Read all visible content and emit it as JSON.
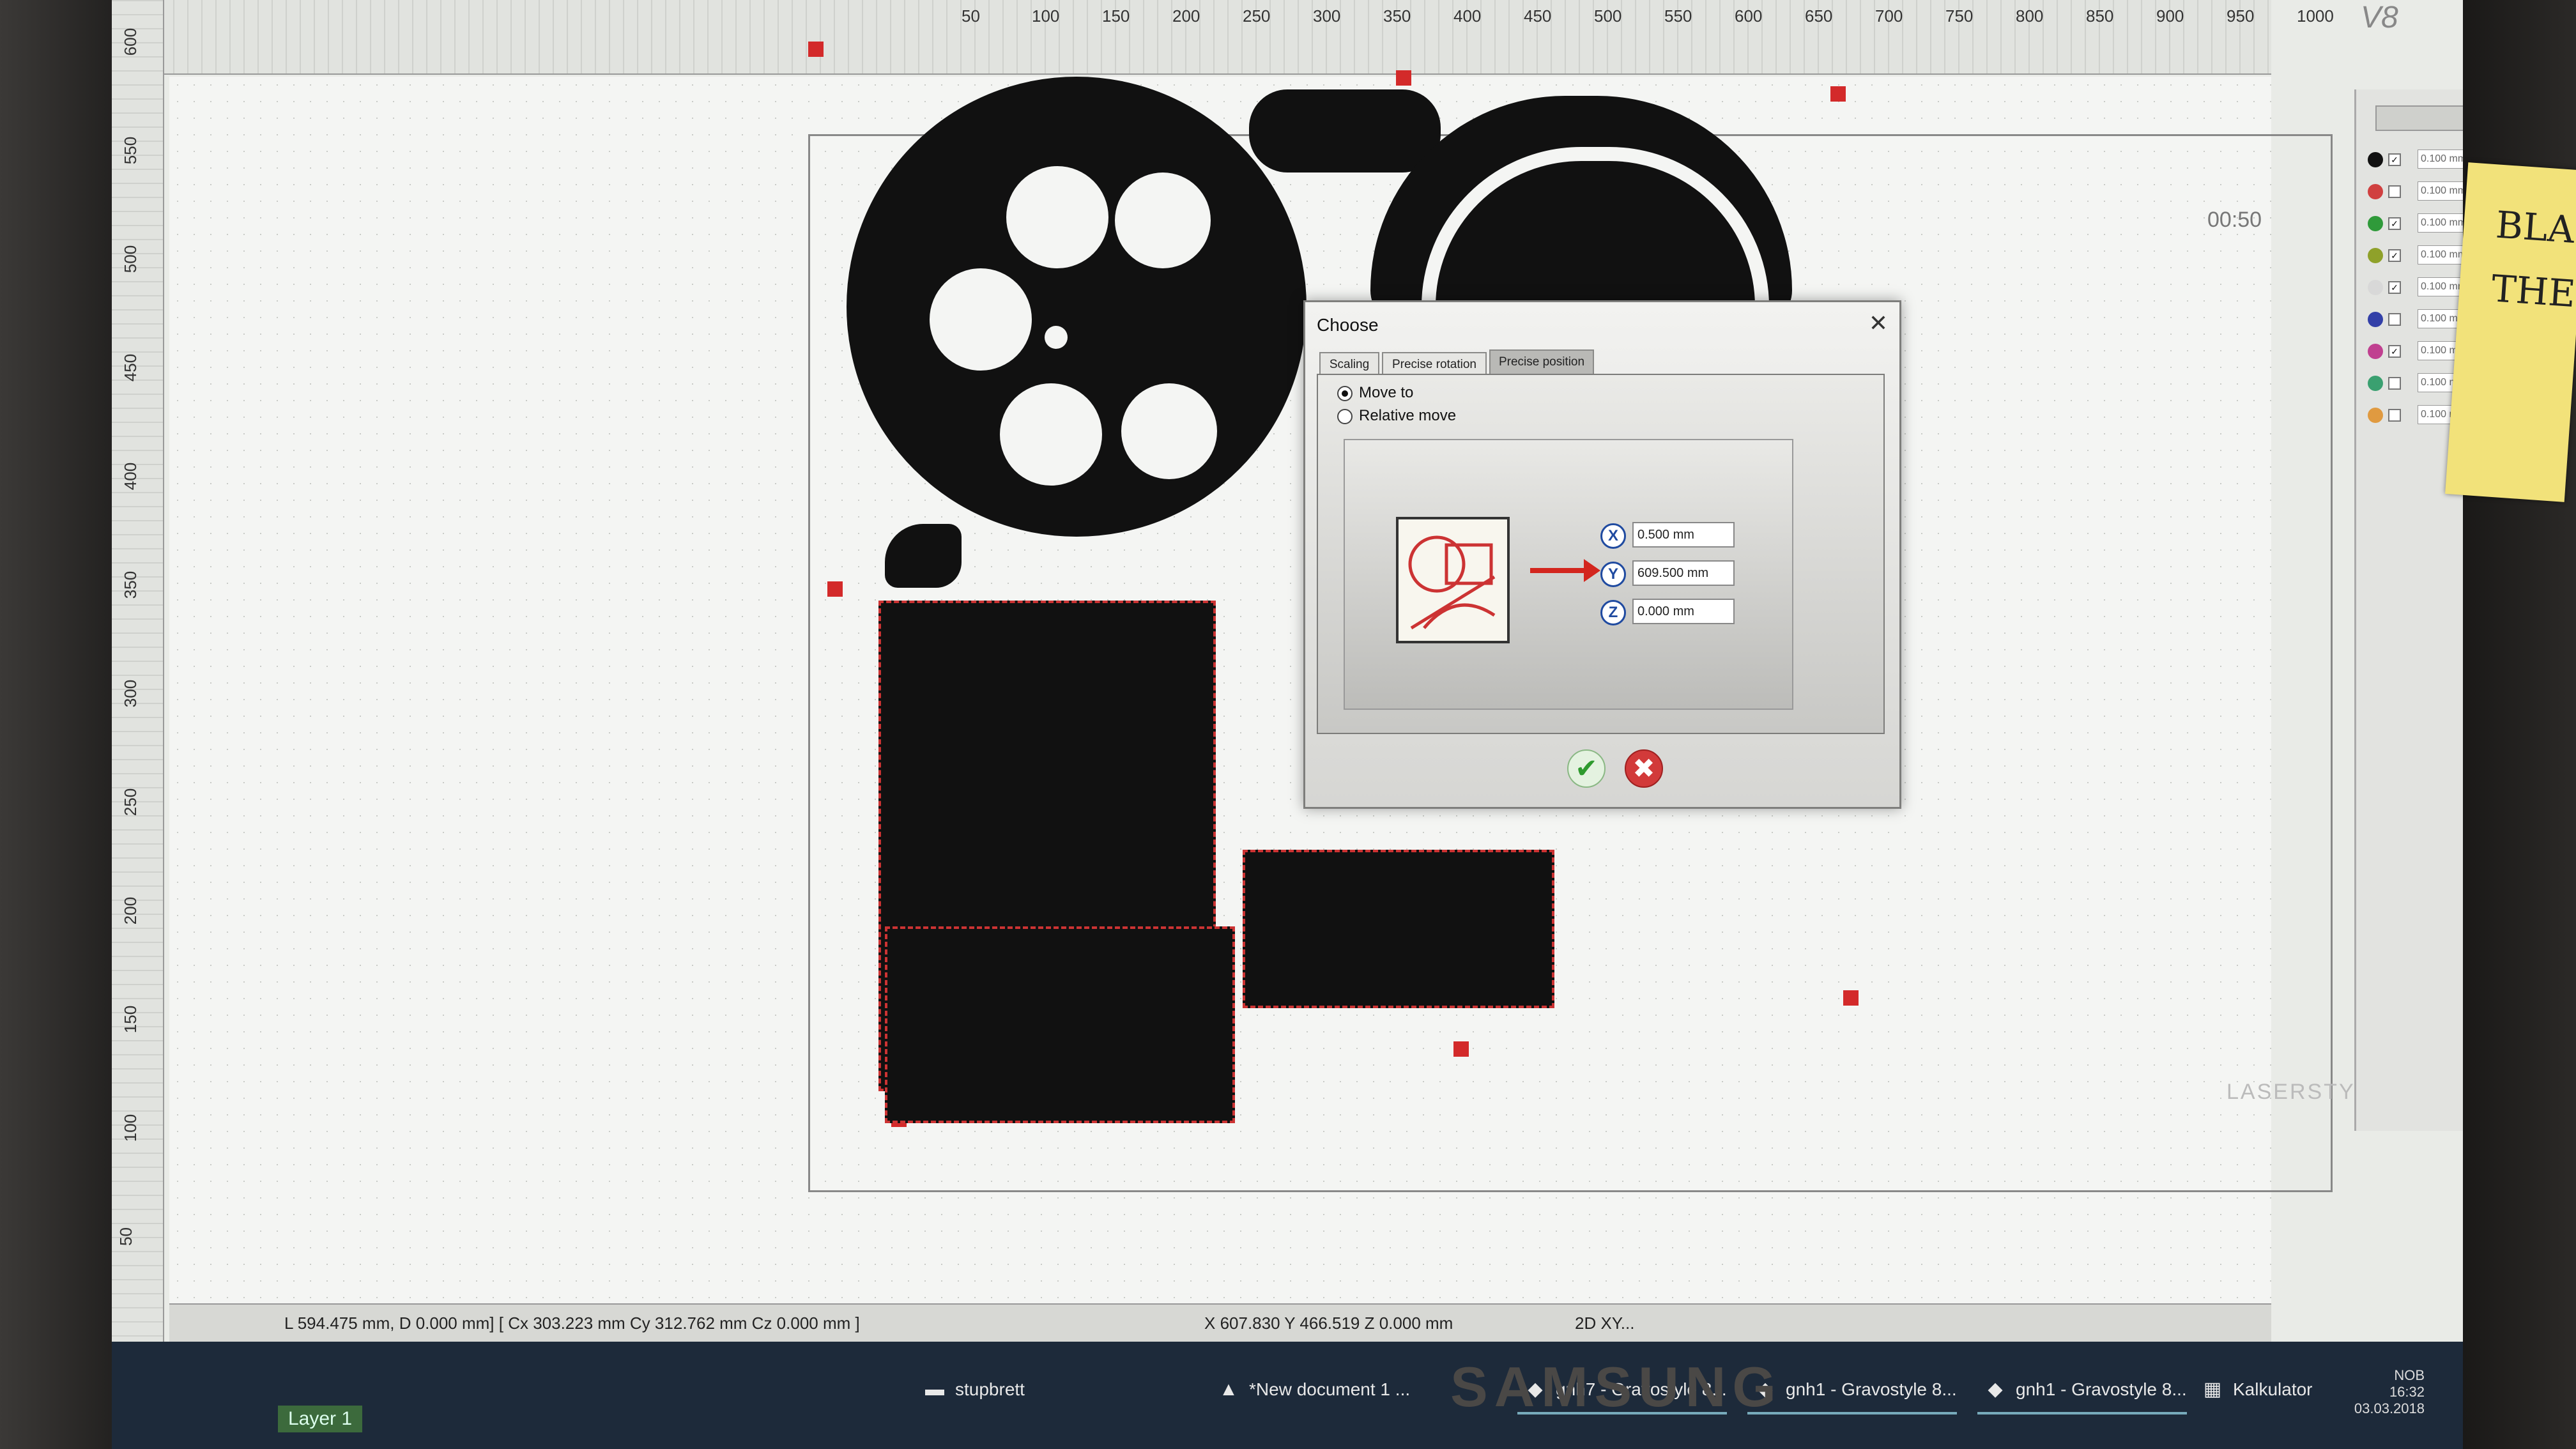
{
  "app": {
    "version_label": "V8",
    "time_label": "00:50",
    "brand_logo": "LASERSTYLE"
  },
  "ruler": {
    "top_labels": [
      "50",
      "100",
      "150",
      "200",
      "250",
      "300",
      "350",
      "400",
      "450",
      "500",
      "550",
      "600",
      "650",
      "700",
      "750",
      "800",
      "850",
      "900",
      "950",
      "1000"
    ],
    "left_labels": [
      "600",
      "550",
      "500",
      "450",
      "400",
      "350",
      "300",
      "250",
      "200",
      "150",
      "100",
      "50"
    ]
  },
  "layers": [
    {
      "color": "#111111",
      "value": "0.100 mm",
      "checked": true
    },
    {
      "color": "#d04040",
      "value": "0.100 mm",
      "checked": false
    },
    {
      "color": "#2f9a3a",
      "value": "0.100 mm",
      "checked": true
    },
    {
      "color": "#8fa12a",
      "value": "0.100 mm",
      "checked": true
    },
    {
      "color": "#d8d8d8",
      "value": "0.100 mm",
      "checked": true
    },
    {
      "color": "#3340a8",
      "value": "0.100 mm",
      "checked": false
    },
    {
      "color": "#c04090",
      "value": "0.100 mm",
      "checked": true
    },
    {
      "color": "#3aa070",
      "value": "0.100 mm",
      "checked": false
    },
    {
      "color": "#e09a40",
      "value": "0.100 mm",
      "checked": false
    }
  ],
  "dialog": {
    "title": "Choose",
    "close_glyph": "✕",
    "tabs": [
      {
        "label": "Scaling",
        "active": false
      },
      {
        "label": "Precise rotation",
        "active": false
      },
      {
        "label": "Precise position",
        "active": true
      }
    ],
    "options": {
      "move_to": "Move to",
      "relative_move": "Relative move",
      "selected": "move_to"
    },
    "fields": {
      "x_label": "X",
      "x_value": "0.500 mm",
      "y_label": "Y",
      "y_value": "609.500 mm",
      "z_label": "Z",
      "z_value": "0.000 mm"
    },
    "ok_glyph": "✔",
    "cancel_glyph": "✖"
  },
  "status": {
    "coords": "X 607.830   Y 466.519   Z 0.000 mm",
    "mode": "2D XY...",
    "selection": "L 594.475 mm, D 0.000 mm] [ Cx 303.223 mm   Cy 312.762 mm   Cz 0.000 mm ]"
  },
  "taskbar": {
    "items": [
      {
        "label": "stupbrett",
        "icon": "folder-icon",
        "glyph": "▬"
      },
      {
        "label": "*New document 1 ...",
        "icon": "app-icon",
        "glyph": "▲"
      },
      {
        "label": "gnh7 - Gravostyle 8...",
        "icon": "gravostyle-icon",
        "glyph": "◆"
      },
      {
        "label": "gnh1 - Gravostyle 8...",
        "icon": "gravostyle-icon",
        "glyph": "◆"
      },
      {
        "label": "gnh1 - Gravostyle 8...",
        "icon": "gravostyle-icon",
        "glyph": "◆"
      },
      {
        "label": "Kalkulator",
        "icon": "calculator-icon",
        "glyph": "▦"
      }
    ],
    "layer_label": "Layer 1",
    "tray_lang": "NOB",
    "tray_time": "16:32",
    "tray_date": "03.03.2018"
  },
  "monitor": {
    "brand": "SAMSUNG"
  },
  "sticky_note": {
    "line1": "BLACK",
    "line2": "THEN"
  }
}
